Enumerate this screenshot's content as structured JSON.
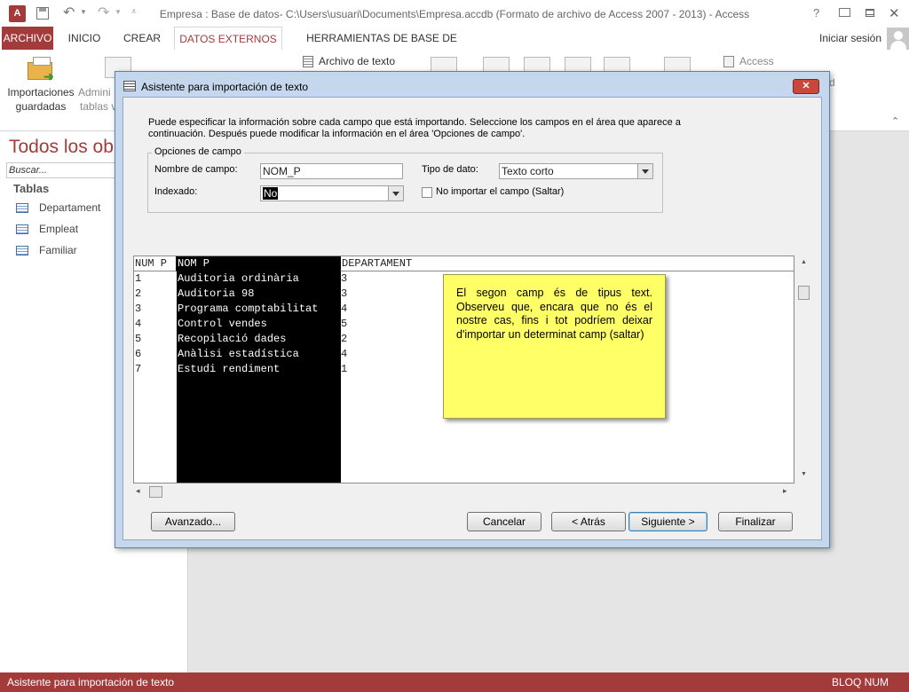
{
  "window": {
    "title": "Empresa : Base de datos- C:\\Users\\usuari\\Documents\\Empresa.accdb (Formato de archivo de Access 2007 - 2013) - Access",
    "help": "?",
    "signin": "Iniciar sesión"
  },
  "ribbon_tabs": [
    {
      "label": "ARCHIVO"
    },
    {
      "label": "INICIO"
    },
    {
      "label": "CREAR"
    },
    {
      "label": "DATOS EXTERNOS"
    },
    {
      "label": "HERRAMIENTAS DE BASE DE DATOS"
    }
  ],
  "ribbon": {
    "saved_imports_line1": "Importaciones",
    "saved_imports_line2": "guardadas",
    "linked_tables_line1": "Admini",
    "linked_tables_line2": "tablas v",
    "text_file": "Archivo de texto",
    "access": "Access",
    "fragment_d": "d"
  },
  "nav": {
    "title": "Todos los ob",
    "search_placeholder": "Buscar...",
    "group": "Tablas",
    "items": [
      {
        "label": "Departament"
      },
      {
        "label": "Empleat"
      },
      {
        "label": "Familiar"
      }
    ]
  },
  "dialog": {
    "title": "Asistente para importación de texto",
    "instructions_line1": "Puede especificar la información sobre cada campo que está importando. Seleccione los campos en el área que aparece a",
    "instructions_line2": "continuación. Después puede modificar la información en el área 'Opciones de campo'.",
    "options_group": "Opciones de campo",
    "field_name_label": "Nombre de campo:",
    "field_name_value": "NOM_P",
    "data_type_label": "Tipo de dato:",
    "data_type_value": "Texto corto",
    "indexed_label": "Indexado:",
    "indexed_value": "No",
    "skip_label": "No importar el campo (Saltar)",
    "skip_checked": false,
    "grid_headers": [
      "NUM P",
      "NOM P",
      "DEPARTAMENT"
    ],
    "grid_rows": [
      [
        "1",
        "Auditoria ordinària",
        "3"
      ],
      [
        "2",
        "Auditoria 98",
        "3"
      ],
      [
        "3",
        "Programa comptabilitat",
        "4"
      ],
      [
        "4",
        "Control vendes",
        "5"
      ],
      [
        "5",
        "Recopilació dades",
        "2"
      ],
      [
        "6",
        "Anàlisi estadística",
        "4"
      ],
      [
        "7",
        "Estudi rendiment",
        "1"
      ]
    ],
    "note": "El segon camp és de tipus text. Observeu que, encara que no és el nostre cas, fins i tot podríem deixar d'importar un determinat camp (saltar)",
    "buttons": {
      "advanced": "Avanzado...",
      "cancel": "Cancelar",
      "back": "< Atrás",
      "next": "Siguiente >",
      "finish": "Finalizar"
    }
  },
  "status": {
    "left": "Asistente para importación de texto",
    "right": "BLOQ NUM"
  },
  "colors": {
    "access_red": "#a33b3b",
    "note_yellow": "#ffff66",
    "dialog_frame": "#c5d7ec"
  }
}
